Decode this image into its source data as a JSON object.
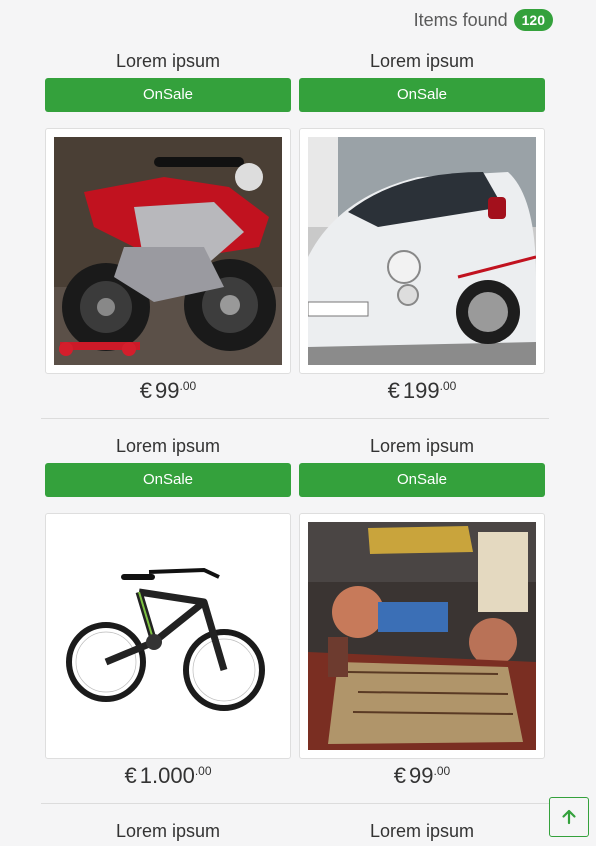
{
  "header": {
    "items_found_label": "Items found",
    "items_count": "120"
  },
  "rows": [
    {
      "left": {
        "title": "Lorem ipsum",
        "button": "OnSale",
        "image": "motorcycle",
        "currency": "€",
        "price": "99",
        "cents": ".00"
      },
      "right": {
        "title": "Lorem ipsum",
        "button": "OnSale",
        "image": "car",
        "currency": "€",
        "price": "199",
        "cents": ".00"
      }
    },
    {
      "left": {
        "title": "Lorem ipsum",
        "button": "OnSale",
        "image": "bicycle",
        "currency": "€",
        "price": "1.000",
        "cents": ".00"
      },
      "right": {
        "title": "Lorem ipsum",
        "button": "OnSale",
        "image": "heroquest-boardgame",
        "currency": "€",
        "price": "99",
        "cents": ".00"
      }
    },
    {
      "left": {
        "title": "Lorem ipsum"
      },
      "right": {
        "title": "Lorem ipsum"
      }
    }
  ],
  "scroll_top": {
    "icon": "arrow-up-icon"
  },
  "colors": {
    "accent": "#34a13c",
    "background": "#f5f5f6"
  }
}
